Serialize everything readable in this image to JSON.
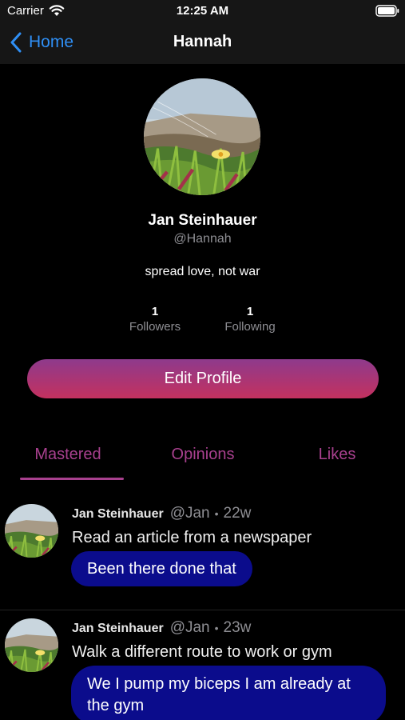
{
  "status_bar": {
    "carrier": "Carrier",
    "time": "12:25 AM",
    "wifi_icon": "wifi-icon",
    "battery_icon": "battery-icon"
  },
  "nav": {
    "back_label": "Home",
    "title": "Hannah",
    "back_icon": "chevron-left-icon"
  },
  "profile": {
    "name": "Jan Steinhauer",
    "handle": "@Hannah",
    "bio": "spread love, not war",
    "followers_count": "1",
    "followers_label": "Followers",
    "following_count": "1",
    "following_label": "Following",
    "edit_button": "Edit Profile"
  },
  "tabs": [
    {
      "label": "Mastered",
      "active": true
    },
    {
      "label": "Opinions",
      "active": false
    },
    {
      "label": "Likes",
      "active": false
    }
  ],
  "posts": [
    {
      "author": "Jan Steinhauer",
      "handle": "@Jan",
      "separator": "•",
      "time": "22w",
      "text": "Read an article from a newspaper",
      "reply": "Been there done that"
    },
    {
      "author": "Jan Steinhauer",
      "handle": "@Jan",
      "separator": "•",
      "time": "23w",
      "text": "Walk a different route to work or gym",
      "reply": "We I pump my biceps I am already at the gym"
    }
  ],
  "colors": {
    "accent": "#a8408e",
    "link": "#2f8ff5",
    "reply_bg": "#0b0c8c",
    "gradient_top": "#8e3a8c",
    "gradient_bottom": "#c4315f"
  }
}
